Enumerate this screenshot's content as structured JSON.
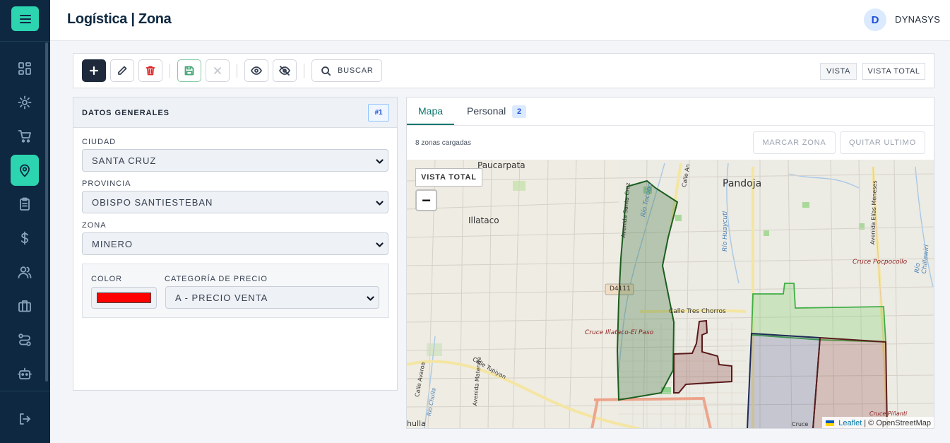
{
  "header": {
    "title": "Logística | Zona",
    "avatar_initial": "D",
    "username": "DYNASYS"
  },
  "sidebar": {
    "items": [
      {
        "name": "dashboard",
        "icon": "grid-icon",
        "active": false
      },
      {
        "name": "settings",
        "icon": "gear-icon",
        "active": false
      },
      {
        "name": "cart",
        "icon": "cart-icon",
        "active": false
      },
      {
        "name": "logistics",
        "icon": "map-pin-icon",
        "active": true
      },
      {
        "name": "clipboard",
        "icon": "clipboard-icon",
        "active": false
      },
      {
        "name": "finance",
        "icon": "dollar-icon",
        "active": false
      },
      {
        "name": "users",
        "icon": "users-icon",
        "active": false
      },
      {
        "name": "briefcase",
        "icon": "briefcase-icon",
        "active": false
      },
      {
        "name": "routes",
        "icon": "route-icon",
        "active": false
      },
      {
        "name": "bot",
        "icon": "robot-icon",
        "active": false
      }
    ],
    "logout_icon": "logout-icon"
  },
  "toolbar": {
    "search_label": "BUSCAR",
    "vista_label": "VISTA",
    "vista_total_label": "VISTA TOTAL"
  },
  "general": {
    "title": "DATOS GENERALES",
    "badge": "#1",
    "ciudad_label": "CIUDAD",
    "ciudad_value": "SANTA CRUZ",
    "provincia_label": "PROVINCIA",
    "provincia_value": "OBISPO SANTIESTEBAN",
    "zona_label": "ZONA",
    "zona_value": "MINERO",
    "color_label": "COLOR",
    "color_value": "#ff0000",
    "categoria_label": "CATEGORÍA DE PRECIO",
    "categoria_value": "A - PRECIO VENTA"
  },
  "map_panel": {
    "tab_mapa": "Mapa",
    "tab_personal": "Personal",
    "personal_count": "2",
    "status": "8 zonas cargadas",
    "marcar_label": "MARCAR ZONA",
    "quitar_label": "QUITAR ULTIMO",
    "vista_total_label": "VISTA TOTAL",
    "zoom_out": "−",
    "attribution_leaflet": "Leaflet",
    "attribution_osm": "| © OpenStreetMap"
  },
  "map_labels": {
    "paucarpata": "Paucarpata",
    "illataco": "Illataco",
    "pandoja": "Pandoja",
    "cruce_pocpocollo": "Cruce Pocpocollo",
    "calle_tres_chorros": "Calle Tres Chorros",
    "cruce_illataco": "Cruce Illataco-El Paso",
    "d4111": "D4111",
    "rio_tocobo": "Río Tocobo",
    "rio_huaycuti": "Río Huaycuti",
    "rio_chillawiri": "Río Chillawiri",
    "avenida_elias": "Avenida Elías Meneses",
    "avenida_santa_cruz": "Avenida Santa Cruz",
    "calle_tupiyan": "Calle Tupiyan",
    "calle_avaroa": "Calle Avaroa",
    "rio_chulla": "Río Chulla",
    "avenida_matende": "Avenida Matende",
    "chulla": "hulla",
    "calle_an": "Calle An",
    "cruce_pinanti": "Cruce Piñanti",
    "cruce": "Cruce"
  }
}
